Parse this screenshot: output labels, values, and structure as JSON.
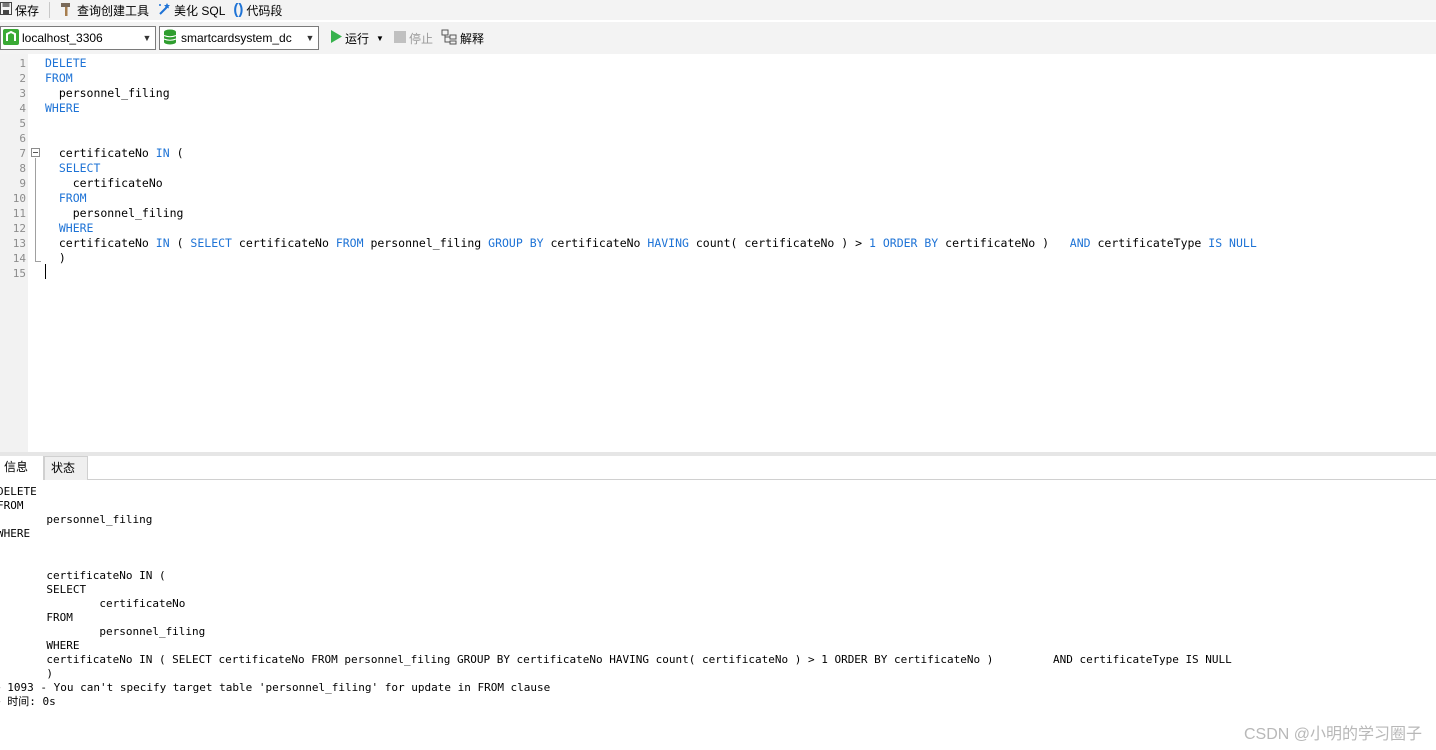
{
  "toolbar": {
    "save_label": "保存",
    "query_builder_label": "查询创建工具",
    "beautify_label": "美化 SQL",
    "snippet_label": "代码段"
  },
  "connection": {
    "value": "localhost_3306",
    "color": "#3aaa35"
  },
  "database": {
    "value": "smartcardsystem_dc"
  },
  "actions": {
    "run_label": "运行",
    "stop_label": "停止",
    "explain_label": "解释"
  },
  "editor": {
    "line_numbers": [
      "1",
      "2",
      "3",
      "4",
      "5",
      "6",
      "7",
      "8",
      "9",
      "10",
      "11",
      "12",
      "13",
      "14",
      "15"
    ],
    "lines": [
      [
        {
          "t": "DELETE",
          "k": true
        }
      ],
      [
        {
          "t": "FROM",
          "k": true
        }
      ],
      [
        {
          "t": "  personnel_filing",
          "k": false
        }
      ],
      [
        {
          "t": "WHERE",
          "k": true
        }
      ],
      [],
      [],
      [
        {
          "t": "  certificateNo ",
          "k": false
        },
        {
          "t": "IN",
          "k": true
        },
        {
          "t": " (",
          "k": false
        }
      ],
      [
        {
          "t": "  ",
          "k": false
        },
        {
          "t": "SELECT",
          "k": true
        }
      ],
      [
        {
          "t": "    certificateNo",
          "k": false
        }
      ],
      [
        {
          "t": "  ",
          "k": false
        },
        {
          "t": "FROM",
          "k": true
        }
      ],
      [
        {
          "t": "    personnel_filing",
          "k": false
        }
      ],
      [
        {
          "t": "  ",
          "k": false
        },
        {
          "t": "WHERE",
          "k": true
        }
      ],
      [
        {
          "t": "  certificateNo ",
          "k": false
        },
        {
          "t": "IN",
          "k": true
        },
        {
          "t": " ( ",
          "k": false
        },
        {
          "t": "SELECT",
          "k": true
        },
        {
          "t": " certificateNo ",
          "k": false
        },
        {
          "t": "FROM",
          "k": true
        },
        {
          "t": " personnel_filing ",
          "k": false
        },
        {
          "t": "GROUP BY",
          "k": true
        },
        {
          "t": " certificateNo ",
          "k": false
        },
        {
          "t": "HAVING",
          "k": true
        },
        {
          "t": " count( certificateNo ) > ",
          "k": false
        },
        {
          "t": "1",
          "k": true
        },
        {
          "t": " ",
          "k": false
        },
        {
          "t": "ORDER BY",
          "k": true
        },
        {
          "t": " certificateNo )   ",
          "k": false
        },
        {
          "t": "AND",
          "k": true
        },
        {
          "t": " certificateType ",
          "k": false
        },
        {
          "t": "IS NULL",
          "k": true
        }
      ],
      [
        {
          "t": "  )",
          "k": false
        }
      ],
      []
    ]
  },
  "tabs": {
    "info_label": "信息",
    "status_label": "状态"
  },
  "messages": {
    "lines": [
      "DELETE",
      "FROM",
      "       personnel_filing",
      "WHERE",
      "",
      "",
      "       certificateNo IN (",
      "       SELECT",
      "               certificateNo",
      "       FROM",
      "               personnel_filing",
      "       WHERE",
      "       certificateNo IN ( SELECT certificateNo FROM personnel_filing GROUP BY certificateNo HAVING count( certificateNo ) > 1 ORDER BY certificateNo )         AND certificateType IS NULL",
      "       )",
      "> 1093 - You can't specify target table 'personnel_filing' for update in FROM clause",
      "> 时间: 0s"
    ]
  },
  "watermark": "CSDN @小明的学习圈子"
}
